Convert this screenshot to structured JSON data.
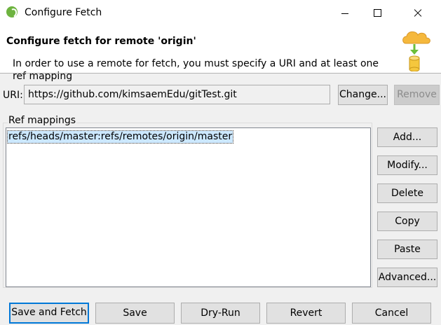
{
  "window": {
    "title": "Configure Fetch"
  },
  "banner": {
    "title": "Configure fetch for remote 'origin'",
    "message": "In order to use a remote for fetch, you must specify a URI and at least one ref mapping"
  },
  "uri": {
    "label": "URI:",
    "value": "https://github.com/kimsaemEdu/gitTest.git",
    "change_label": "Change...",
    "remove_label": "Remove"
  },
  "refmappings": {
    "label": "Ref mappings",
    "items": [
      "refs/heads/master:refs/remotes/origin/master"
    ]
  },
  "side_buttons": {
    "add": "Add...",
    "modify": "Modify...",
    "delete": "Delete",
    "copy": "Copy",
    "paste": "Paste",
    "advanced": "Advanced..."
  },
  "bottom_buttons": {
    "save_fetch": "Save and Fetch",
    "save": "Save",
    "dry_run": "Dry-Run",
    "revert": "Revert",
    "cancel": "Cancel"
  },
  "colors": {
    "accent": "#0078d7",
    "selection": "#cce8ff",
    "icon_cloud": "#f5b83d",
    "icon_arrow": "#6cbf3a"
  }
}
